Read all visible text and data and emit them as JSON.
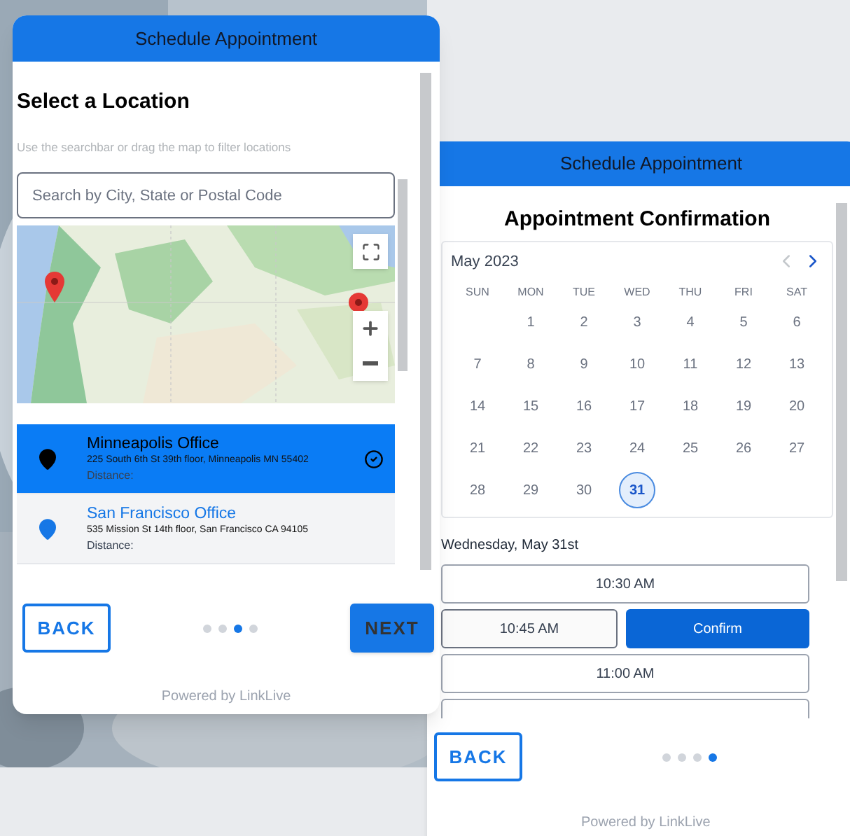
{
  "location_window": {
    "title": "Schedule Appointment",
    "heading": "Select a Location",
    "hint": "Use the searchbar or drag the map to filter locations",
    "search": {
      "placeholder": "Search by City, State or Postal Code"
    },
    "locations": [
      {
        "name": "Minneapolis Office",
        "address": "225 South 6th St 39th floor, Minneapolis MN 55402",
        "distance": "Distance:",
        "selected": true
      },
      {
        "name": "San Francisco Office",
        "address": "535 Mission St 14th floor, San Francisco CA 94105",
        "distance": "Distance:",
        "selected": false
      }
    ],
    "back": "BACK",
    "next": "NEXT",
    "steps": [
      {
        "selected": false
      },
      {
        "selected": false
      },
      {
        "selected": true
      },
      {
        "selected": false
      }
    ],
    "footer": "Powered by LinkLive"
  },
  "confirmation_window": {
    "title": "Schedule Appointment",
    "heading": "Appointment Confirmation",
    "month": "May 2023",
    "weekdays": [
      "SUN",
      "MON",
      "TUE",
      "WED",
      "THU",
      "FRI",
      "SAT"
    ],
    "weeks": [
      [
        {
          "kind": "empty"
        },
        {
          "kind": "day",
          "day": "1",
          "selected": false
        },
        {
          "kind": "day",
          "day": "2",
          "selected": false
        },
        {
          "kind": "day",
          "day": "3",
          "selected": false
        },
        {
          "kind": "day",
          "day": "4",
          "selected": false
        },
        {
          "kind": "day",
          "day": "5",
          "selected": false
        },
        {
          "kind": "day",
          "day": "6",
          "selected": false
        }
      ],
      [
        {
          "kind": "day",
          "day": "7",
          "selected": false
        },
        {
          "kind": "day",
          "day": "8",
          "selected": false
        },
        {
          "kind": "day",
          "day": "9",
          "selected": false
        },
        {
          "kind": "day",
          "day": "10",
          "selected": false
        },
        {
          "kind": "day",
          "day": "11",
          "selected": false
        },
        {
          "kind": "day",
          "day": "12",
          "selected": false
        },
        {
          "kind": "day",
          "day": "13",
          "selected": false
        }
      ],
      [
        {
          "kind": "day",
          "day": "14",
          "selected": false
        },
        {
          "kind": "day",
          "day": "15",
          "selected": false
        },
        {
          "kind": "day",
          "day": "16",
          "selected": false
        },
        {
          "kind": "day",
          "day": "17",
          "selected": false
        },
        {
          "kind": "day",
          "day": "18",
          "selected": false
        },
        {
          "kind": "day",
          "day": "19",
          "selected": false
        },
        {
          "kind": "day",
          "day": "20",
          "selected": false
        }
      ],
      [
        {
          "kind": "day",
          "day": "21",
          "selected": false
        },
        {
          "kind": "day",
          "day": "22",
          "selected": false
        },
        {
          "kind": "day",
          "day": "23",
          "selected": false
        },
        {
          "kind": "day",
          "day": "24",
          "selected": false
        },
        {
          "kind": "day",
          "day": "25",
          "selected": false
        },
        {
          "kind": "day",
          "day": "26",
          "selected": false
        },
        {
          "kind": "day",
          "day": "27",
          "selected": false
        }
      ],
      [
        {
          "kind": "day",
          "day": "28",
          "selected": false
        },
        {
          "kind": "day",
          "day": "29",
          "selected": false
        },
        {
          "kind": "day",
          "day": "30",
          "selected": false
        },
        {
          "kind": "day",
          "day": "31",
          "selected": true
        },
        {
          "kind": "empty"
        },
        {
          "kind": "empty"
        },
        {
          "kind": "empty"
        }
      ]
    ],
    "date_label": "Wednesday, May 31st",
    "slots": [
      {
        "time": "10:30 AM",
        "selected": false
      },
      {
        "time": "10:45 AM",
        "selected": true
      },
      {
        "time": "11:00 AM",
        "selected": false
      }
    ],
    "confirm": "Confirm",
    "back": "BACK",
    "steps": [
      {
        "selected": false
      },
      {
        "selected": false
      },
      {
        "selected": false
      },
      {
        "selected": true
      }
    ],
    "footer": "Powered by LinkLive"
  }
}
